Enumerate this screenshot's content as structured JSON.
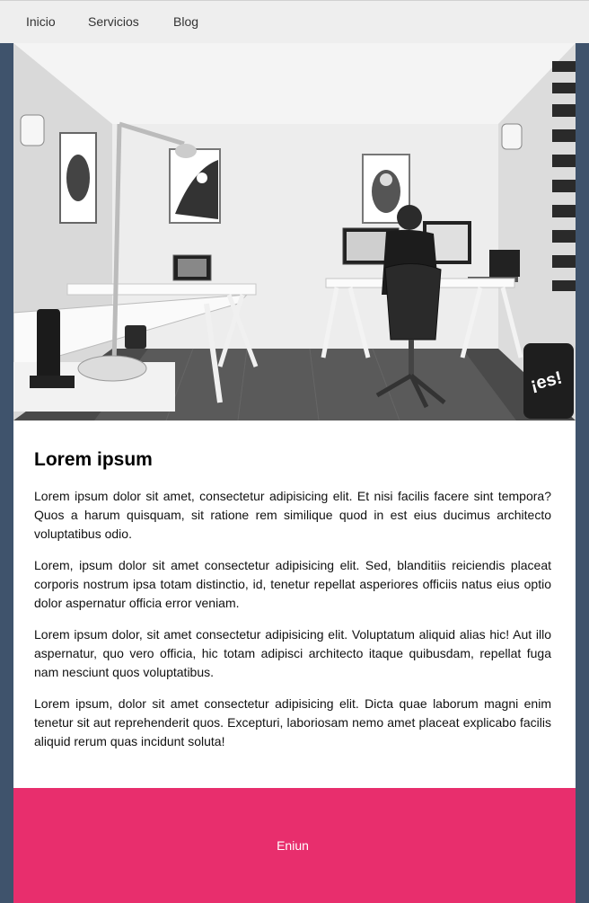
{
  "nav": {
    "items": [
      {
        "label": "Inicio"
      },
      {
        "label": "Servicios"
      },
      {
        "label": "Blog"
      }
    ]
  },
  "hero": {
    "image_icon": "office-workspace-photo",
    "poster_text": "¡es!"
  },
  "article": {
    "title": "Lorem ipsum",
    "paragraphs": [
      "Lorem ipsum dolor sit amet, consectetur adipisicing elit. Et nisi facilis facere sint tempora? Quos a harum quisquam, sit ratione rem similique quod in est eius ducimus architecto voluptatibus odio.",
      "Lorem, ipsum dolor sit amet consectetur adipisicing elit. Sed, blanditiis reiciendis placeat corporis nostrum ipsa totam distinctio, id, tenetur repellat asperiores officiis natus eius optio dolor aspernatur officia error veniam.",
      "Lorem ipsum dolor, sit amet consectetur adipisicing elit. Voluptatum aliquid alias hic! Aut illo aspernatur, quo vero officia, hic totam adipisci architecto itaque quibusdam, repellat fuga nam nesciunt quos voluptatibus.",
      "Lorem ipsum, dolor sit amet consectetur adipisicing elit. Dicta quae laborum magni enim tenetur sit aut reprehenderit quos. Excepturi, laboriosam nemo amet placeat explicabo facilis aliquid rerum quas incidunt soluta!"
    ]
  },
  "footer": {
    "text": "Eniun"
  },
  "colors": {
    "background": "#3f536c",
    "navbar": "#eeeeee",
    "footer": "#e82e6d"
  }
}
